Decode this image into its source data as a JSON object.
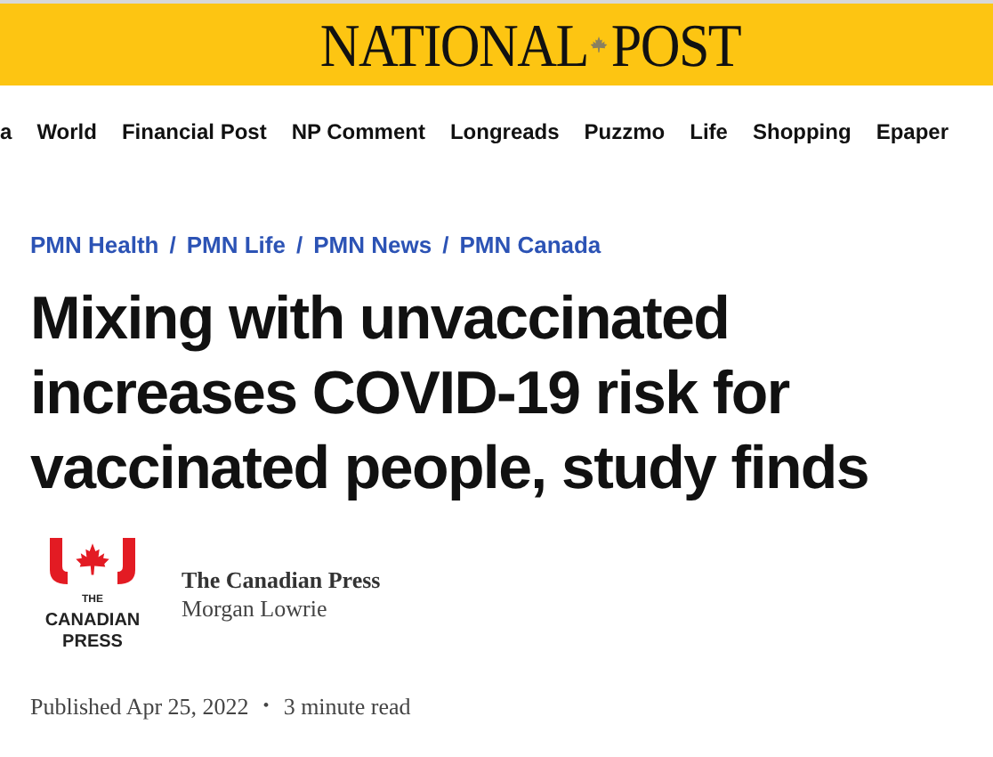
{
  "masthead": {
    "left": "NATIONAL",
    "right": "POST"
  },
  "nav": [
    {
      "label": "a"
    },
    {
      "label": "World"
    },
    {
      "label": "Financial Post"
    },
    {
      "label": "NP Comment"
    },
    {
      "label": "Longreads"
    },
    {
      "label": "Puzzmo"
    },
    {
      "label": "Life"
    },
    {
      "label": "Shopping"
    },
    {
      "label": "Epaper"
    }
  ],
  "breadcrumbs": {
    "items": [
      "PMN Health",
      "PMN Life",
      "PMN News",
      "PMN Canada"
    ],
    "separator": "/"
  },
  "headline": "Mixing with unvaccinated increases COVID-19 risk for vaccinated people, study finds",
  "byline": {
    "logo": [
      "THE",
      "CANADIAN",
      "PRESS"
    ],
    "source": "The Canadian Press",
    "author": "Morgan Lowrie"
  },
  "meta": {
    "published": "Published Apr 25, 2022",
    "separator": "•",
    "read_time": "3 minute read"
  }
}
